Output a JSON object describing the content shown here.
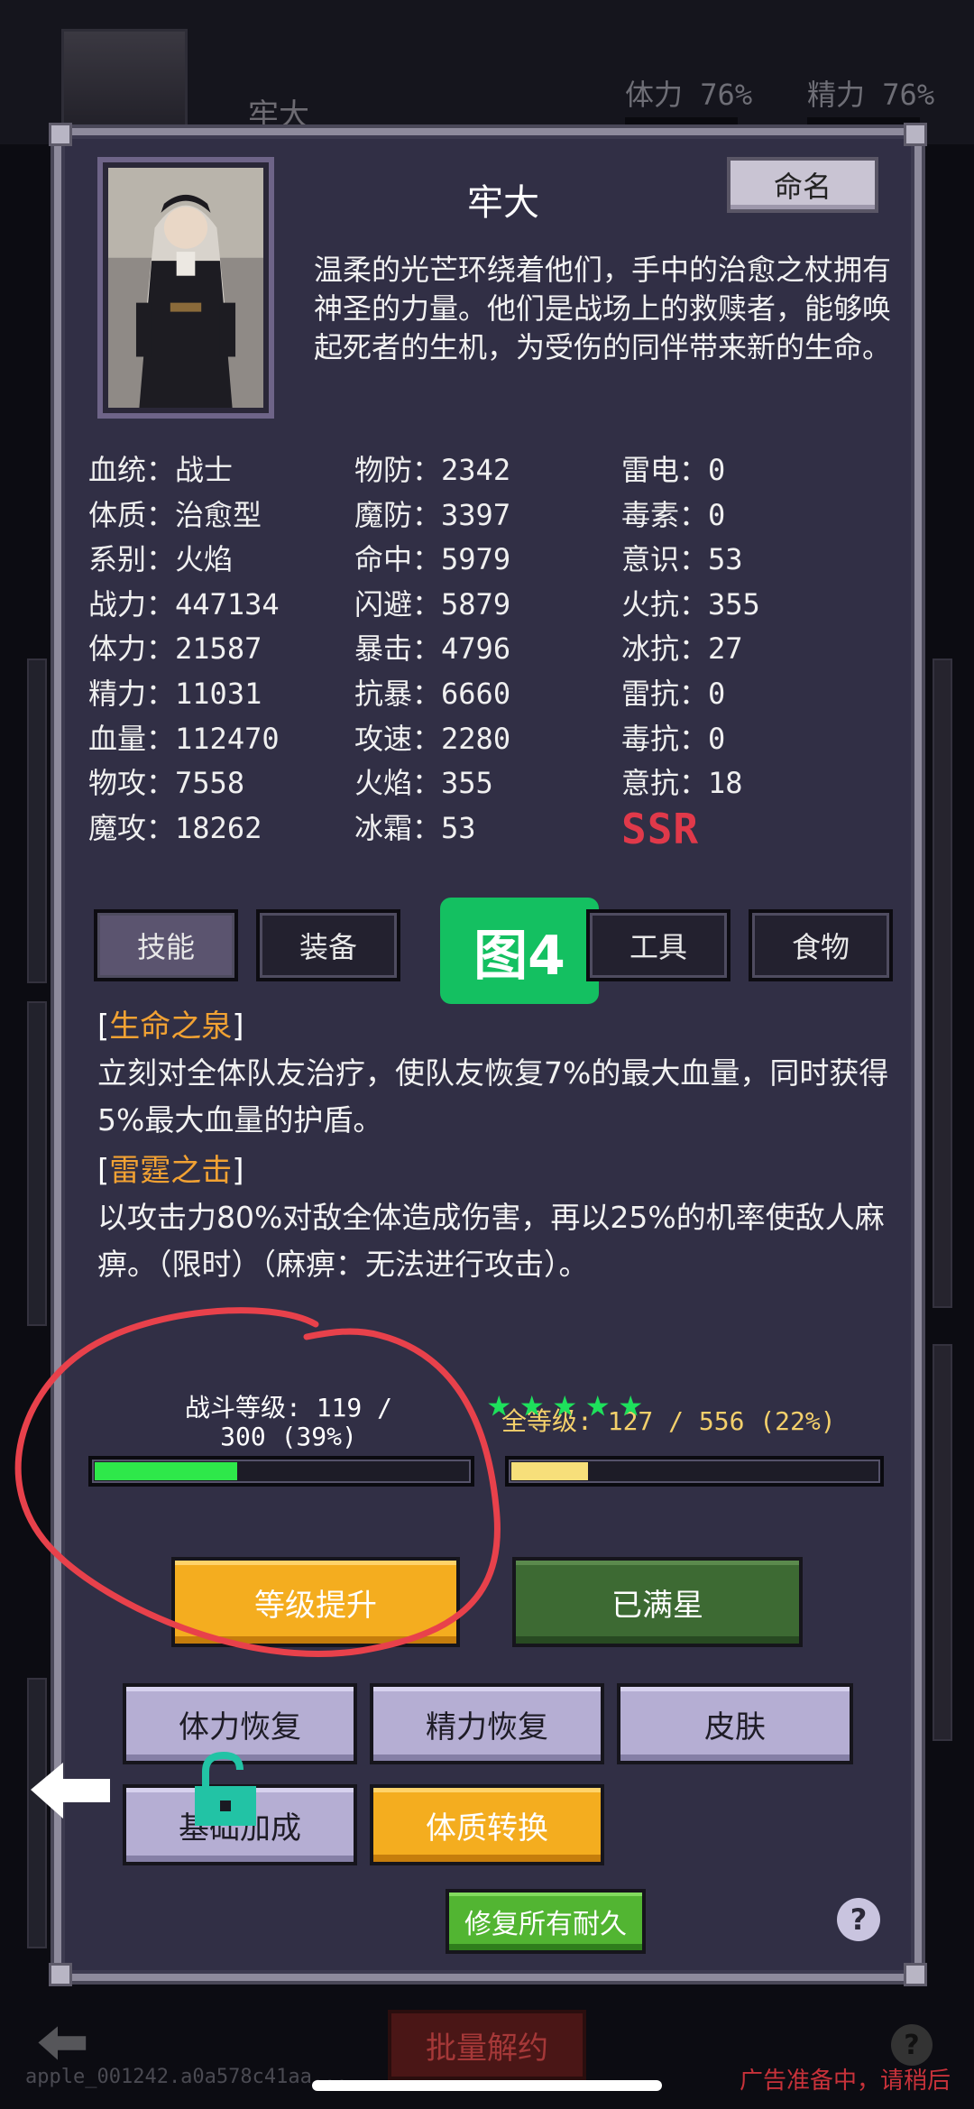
{
  "background": {
    "name": "牢大",
    "stats": [
      {
        "label": "体力",
        "value": "76%",
        "color": "#c48a2a"
      },
      {
        "label": "精力",
        "value": "76%",
        "color": "#2f9ea0"
      }
    ],
    "footer_id": "apple_001242.a0a578c41aa...",
    "ad_text": "广告准备中，请稍后",
    "bottom_button": "批量解约"
  },
  "character": {
    "name": "牢大",
    "rename_label": "命名",
    "description": "温柔的光芒环绕着他们，手中的治愈之杖拥有神圣的力量。他们是战场上的救赎者，能够唤起死者的生机，为受伤的同伴带来新的生命。"
  },
  "stats": {
    "col1": [
      {
        "k": "血统",
        "v": "战士"
      },
      {
        "k": "体质",
        "v": "治愈型"
      },
      {
        "k": "系别",
        "v": "火焰"
      },
      {
        "k": "战力",
        "v": "447134"
      },
      {
        "k": "体力",
        "v": "21587"
      },
      {
        "k": "精力",
        "v": "11031"
      },
      {
        "k": "血量",
        "v": "112470"
      },
      {
        "k": "物攻",
        "v": "7558"
      },
      {
        "k": "魔攻",
        "v": "18262"
      }
    ],
    "col2": [
      {
        "k": "物防",
        "v": "2342"
      },
      {
        "k": "魔防",
        "v": "3397"
      },
      {
        "k": "命中",
        "v": "5979"
      },
      {
        "k": "闪避",
        "v": "5879"
      },
      {
        "k": "暴击",
        "v": "4796"
      },
      {
        "k": "抗暴",
        "v": "6660"
      },
      {
        "k": "攻速",
        "v": "2280"
      },
      {
        "k": "火焰",
        "v": "355"
      },
      {
        "k": "冰霜",
        "v": "53"
      }
    ],
    "col3": [
      {
        "k": "雷电",
        "v": "0"
      },
      {
        "k": "毒素",
        "v": "0"
      },
      {
        "k": "意识",
        "v": "53"
      },
      {
        "k": "火抗",
        "v": "355"
      },
      {
        "k": "冰抗",
        "v": "27"
      },
      {
        "k": "雷抗",
        "v": "0"
      },
      {
        "k": "毒抗",
        "v": "0"
      },
      {
        "k": "意抗",
        "v": "18"
      }
    ],
    "rarity": "SSR"
  },
  "tabs": [
    {
      "label": "技能",
      "active": true
    },
    {
      "label": "装备",
      "active": false
    },
    {
      "label": "工具",
      "active": false
    },
    {
      "label": "食物",
      "active": false
    }
  ],
  "figure_label": "图4",
  "skills": [
    {
      "name": "生命之泉",
      "text": "立刻对全体队友治疗，使队友恢复7%的最大血量，同时获得5%最大血量的护盾。"
    },
    {
      "name": "雷霆之击",
      "text": "以攻击力80%对敌全体造成伤害，再以25%的机率使敌人麻痹。（限时）（麻痹：无法进行攻击）。"
    }
  ],
  "battle_level": {
    "label_line1": "战斗等级: 119 /",
    "label_line2": "300 (39%)",
    "progress": 0.39,
    "color": "#2ee84a"
  },
  "total_level": {
    "label": "全等级: 127 / 556 (22%)",
    "progress": 0.22,
    "color": "#f7df7a"
  },
  "stars": {
    "count": 5,
    "symbol": "★",
    "color": "#1ee05c"
  },
  "buttons": {
    "level_up": "等级提升",
    "max_star": "已满星",
    "stamina_restore": "体力恢复",
    "energy_restore": "精力恢复",
    "skin": "皮肤",
    "base_bonus": "基础加成",
    "constitution_convert": "体质转换",
    "repair_all": "修复所有耐久"
  },
  "icons": {
    "back": "arrow-left-icon",
    "lock": "unlock-icon",
    "help": "?"
  },
  "annotation_color": "#e8414b"
}
